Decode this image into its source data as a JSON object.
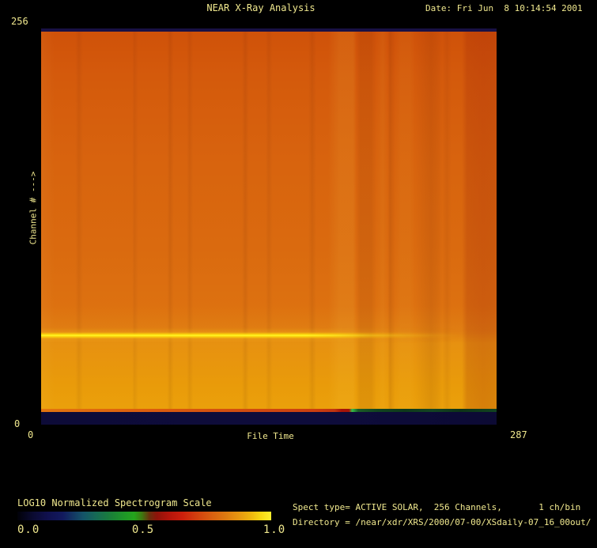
{
  "window": {
    "background_color": "#000000",
    "text_color": "#f0e88e"
  },
  "header": {
    "title": "NEAR X-Ray Analysis",
    "date": "Date: Fri Jun  8 10:14:54 2001"
  },
  "plot": {
    "y_axis": {
      "title": "Channel # --->",
      "max_tick": "256",
      "min_tick": "0"
    },
    "x_axis": {
      "title": "File Time",
      "min_tick": "0",
      "max_tick": "287"
    }
  },
  "colorbar": {
    "title": "LOG10 Normalized Spectrogram Scale",
    "ticks": [
      "0.0",
      "0.5",
      "1.0"
    ],
    "gradient_colors": [
      "#010108",
      "#10104e",
      "#145468",
      "#1e9628",
      "#8f130a",
      "#cb1f0c",
      "#d85c10",
      "#e69610",
      "#fcee2e"
    ]
  },
  "info": {
    "spect_line": "Spect type= ACTIVE SOLAR,  256 Channels,       1 ch/bin",
    "directory_line": "Directory = /near/xdr/XRS/2000/07-00/XSdaily-07_16_00out/"
  },
  "chart_data": {
    "type": "heatmap",
    "title": "NEAR X-Ray Analysis",
    "xlabel": "File Time",
    "ylabel": "Channel #",
    "x_range": [
      0,
      287
    ],
    "y_range": [
      0,
      256
    ],
    "colorbar": {
      "label": "LOG10 Normalized Spectrogram Scale",
      "ticks": [
        0.0,
        0.5,
        1.0
      ]
    },
    "features": [
      {
        "name": "bright-emission-line",
        "channel": 58,
        "x_extent": [
          0,
          258
        ],
        "normalized_value": 1.0,
        "color": "#fff200"
      },
      {
        "name": "background-continuum",
        "normalized_value_range": [
          0.75,
          0.9
        ],
        "description": "uniform orange continuum, slightly brighter below the emission line",
        "color": "#d8650e"
      },
      {
        "name": "low-channel-dark-band",
        "channels": [
          0,
          7
        ],
        "normalized_value": 0.05,
        "color": "#0d0b38"
      },
      {
        "name": "low-channel-green-segment",
        "channels": [
          7,
          9
        ],
        "x_extent": [
          198,
          287
        ],
        "normalized_value": 0.4,
        "color": "#114420"
      },
      {
        "name": "high-channel-dark-row",
        "channels": [
          254,
          256
        ],
        "normalized_value": 0.05,
        "color": "#191145"
      },
      {
        "name": "vertical-banding",
        "x_extent": [
          188,
          287
        ],
        "description": "alternating lighter/darker time columns; darkest red-orange column at far right"
      }
    ]
  }
}
